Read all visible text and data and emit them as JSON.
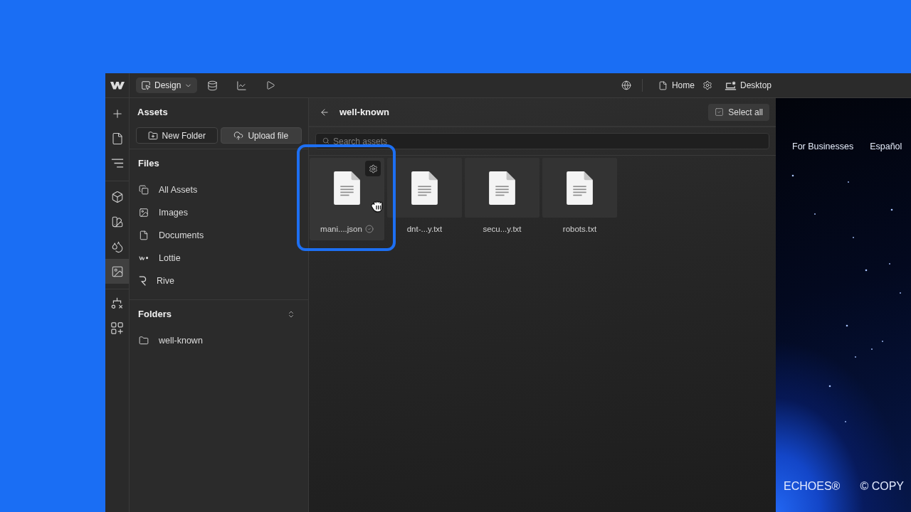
{
  "toolbar": {
    "mode_button": {
      "label": "Design"
    },
    "page_selector": {
      "label": "Home"
    },
    "breakpoint_selector": {
      "label": "Desktop"
    }
  },
  "rail": {
    "items": [
      {
        "selected": false
      },
      {
        "selected": false
      },
      {
        "selected": false
      },
      {
        "selected": false
      },
      {
        "selected": false
      },
      {
        "selected": false
      },
      {
        "selected": true
      },
      {
        "selected": false
      },
      {
        "selected": false
      }
    ]
  },
  "sidebar": {
    "title": "Assets",
    "buttons": [
      {
        "label": "New Folder",
        "kind": "outline"
      },
      {
        "label": "Upload file",
        "kind": "filled"
      }
    ],
    "files": {
      "title": "Files",
      "items": [
        "All Assets",
        "Images",
        "Documents",
        "Lottie",
        "Rive"
      ]
    },
    "folders": {
      "title": "Folders",
      "items": [
        "well-known"
      ]
    }
  },
  "browser": {
    "title": "well-known",
    "select_all": {
      "label": "Select all"
    },
    "search": {
      "placeholder": "Search assets"
    },
    "assets": [
      {
        "name": "mani....json",
        "hovered": true,
        "highlighted": true
      },
      {
        "name": "dnt-...y.txt",
        "hovered": false,
        "highlighted": false
      },
      {
        "name": "secu...y.txt",
        "hovered": false,
        "highlighted": false
      },
      {
        "name": "robots.txt",
        "hovered": false,
        "highlighted": false
      }
    ]
  },
  "preview": {
    "nav_links": [
      "For Businesses",
      "Español"
    ],
    "footer": [
      "ECHOES®",
      "© COPY"
    ]
  }
}
